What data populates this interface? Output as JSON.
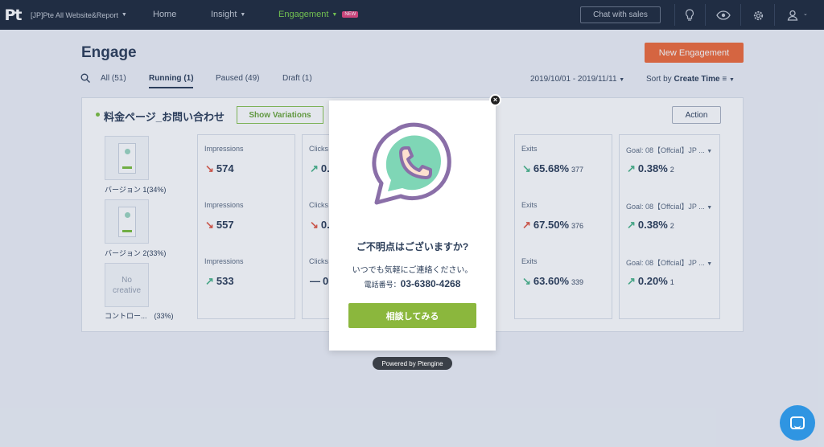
{
  "nav": {
    "logo": "Pt",
    "site": "[JP]Pte All Website&Report",
    "home": "Home",
    "insight": "Insight",
    "engagement": "Engagement",
    "new_badge": "NEW",
    "chat_sales": "Chat with sales",
    "icons": [
      "lightbulb-icon",
      "eye-icon",
      "gear-icon",
      "user-icon"
    ]
  },
  "page": {
    "title": "Engage",
    "new_button": "New Engagement",
    "filters": {
      "all": "All (51)",
      "running": "Running (1)",
      "paused": "Paused (49)",
      "draft": "Draft (1)"
    },
    "date_range": "2019/10/01 - 2019/11/11",
    "sort_prefix": "Sort by",
    "sort_value": "Create Time"
  },
  "panel": {
    "title": "料金ページ_お問い合わせ",
    "show_variations": "Show Variations",
    "action": "Action",
    "variations": [
      {
        "label": "バージョン 1(34%)",
        "thumb": ""
      },
      {
        "label": "バージョン 2(33%)",
        "thumb": ""
      },
      {
        "label": "コントロー...　(33%)",
        "thumb": "No creative"
      }
    ],
    "impressions": {
      "label": "Impressions",
      "rows": [
        {
          "value": "574",
          "trend": "↘"
        },
        {
          "value": "557",
          "trend": "↘"
        },
        {
          "value": "533",
          "trend": "↗"
        }
      ]
    },
    "clicks": {
      "label": "Clicks",
      "rows": [
        {
          "value": "0.",
          "trend": "↗"
        },
        {
          "value": "0.",
          "trend": "↘"
        },
        {
          "value": "0",
          "trend": "—"
        }
      ]
    },
    "exits": {
      "label": "Exits",
      "rows": [
        {
          "value": "65.68%",
          "count": "377",
          "trend": "↘"
        },
        {
          "value": "67.50%",
          "count": "376",
          "trend": "↗"
        },
        {
          "value": "63.60%",
          "count": "339",
          "trend": "↘"
        }
      ]
    },
    "goal": {
      "label": "Goal: 08【Offcial】JP ...",
      "rows": [
        {
          "value": "0.38%",
          "count": "2",
          "trend": "↗"
        },
        {
          "value": "0.38%",
          "count": "2",
          "trend": "↗"
        },
        {
          "value": "0.20%",
          "count": "1",
          "trend": "↗"
        }
      ]
    }
  },
  "modal": {
    "heading": "ご不明点はございますか?",
    "sub": "いつでも気軽にご連絡ください。",
    "phone_label": "電話番号：",
    "phone": "03-6380-4268",
    "button": "相談してみる",
    "close": "×",
    "powered": "Powered by Ptengine"
  },
  "colors": {
    "accent": "#ef6b3b",
    "green": "#8bb73d",
    "nav_bg": "#1f2b3d",
    "chat": "#2f95e2"
  }
}
